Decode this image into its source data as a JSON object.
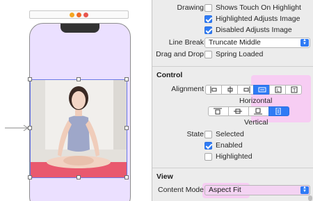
{
  "canvas": {
    "scene_icons": [
      "view-controller-icon",
      "first-responder-icon",
      "exit-icon"
    ],
    "image": {
      "subject": "woman-sitting-cross-legged-on-yoga-mat"
    }
  },
  "inspector": {
    "drawing": {
      "label": "Drawing",
      "items": [
        {
          "label": "Shows Touch On Highlight",
          "checked": false
        },
        {
          "label": "Highlighted Adjusts Image",
          "checked": true
        },
        {
          "label": "Disabled Adjusts Image",
          "checked": true
        }
      ]
    },
    "line_break": {
      "label": "Line Break",
      "value": "Truncate Middle"
    },
    "drag_and_drop": {
      "label": "Drag and Drop",
      "checkbox_label": "Spring Loaded",
      "checked": false
    },
    "control": {
      "section_title": "Control",
      "alignment_label": "Alignment",
      "horizontal_caption": "Horizontal",
      "vertical_caption": "Vertical",
      "horizontal_options": [
        "left",
        "center",
        "right",
        "fill",
        "leading",
        "trailing"
      ],
      "horizontal_selected": "fill",
      "vertical_options": [
        "top",
        "center",
        "bottom",
        "fill"
      ],
      "vertical_selected": "fill",
      "state": {
        "label": "State",
        "items": [
          {
            "label": "Selected",
            "checked": false
          },
          {
            "label": "Enabled",
            "checked": true
          },
          {
            "label": "Highlighted",
            "checked": false
          }
        ]
      }
    },
    "view": {
      "section_title": "View",
      "content_mode_label": "Content Mode",
      "content_mode_value": "Aspect Fit"
    }
  },
  "colors": {
    "accent": "#2f7bf5",
    "highlight_pink": "#f7cdf3",
    "scene_background": "#ebe0ff"
  }
}
